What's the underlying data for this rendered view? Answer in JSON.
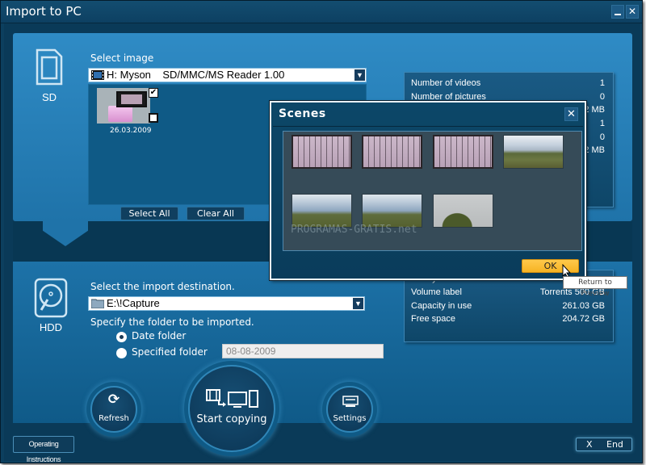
{
  "window": {
    "title": "Import to PC",
    "minimize_icon": "minimize-icon",
    "close_icon": "close-icon"
  },
  "source": {
    "device_label": "SD",
    "device_icon": "sd-card-icon",
    "select_label": "Select image",
    "drive_select": {
      "icon": "film-strip-icon",
      "value": "H: Myson    SD/MMC/MS Reader 1.00"
    },
    "thumbnails": [
      {
        "date": "26.03.2009",
        "checked": true,
        "type_icon": "video-icon"
      }
    ],
    "select_all_label": "Select All",
    "clear_all_label": "Clear All",
    "info": [
      {
        "key": "Number of videos",
        "value": "1"
      },
      {
        "key": "Number of pictures",
        "value": "0"
      },
      {
        "key": "",
        "value": "2 MB"
      },
      {
        "key": "",
        "value": "1"
      },
      {
        "key": "",
        "value": "0"
      },
      {
        "key": "",
        "value": "2 MB"
      }
    ]
  },
  "destination": {
    "device_label": "HDD",
    "device_icon": "hard-drive-icon",
    "select_label": "Select the import destination.",
    "folder_select": {
      "icon": "folder-icon",
      "value": "E:\\!Capture"
    },
    "folder_label": "Specify the folder to be imported.",
    "radio_options": [
      {
        "label": "Date folder",
        "checked": true
      },
      {
        "label": "Specified folder",
        "checked": false
      }
    ],
    "specified_folder_value": "08-08-2009",
    "info": [
      {
        "key": "File system",
        "value": ""
      },
      {
        "key": "Volume label",
        "value": "Torrents 500 GB"
      },
      {
        "key": "Capacity in use",
        "value": "261.03 GB"
      },
      {
        "key": "Free space",
        "value": "204.72 GB"
      }
    ]
  },
  "actions": {
    "refresh_label": "Refresh",
    "start_copying_label": "Start copying",
    "settings_label": "Settings",
    "operating_instructions_label": "Operating Instructions",
    "end_x": "X",
    "end_label": "End"
  },
  "scenes_dialog": {
    "title": "Scenes",
    "close_glyph": "✕",
    "scenes": [
      {
        "kind": "test-chart"
      },
      {
        "kind": "test-chart"
      },
      {
        "kind": "test-chart"
      },
      {
        "kind": "field-road"
      },
      {
        "kind": "sky-field"
      },
      {
        "kind": "sky-field"
      },
      {
        "kind": "tree-sky"
      }
    ],
    "ok_label": "OK",
    "tooltip": "Return to Preview"
  },
  "watermark": "PROGRAMAS-GRATIS.net"
}
